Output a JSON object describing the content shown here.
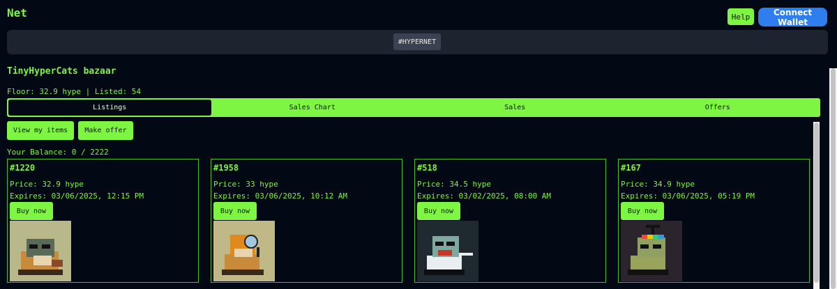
{
  "header": {
    "app_title": "Net",
    "help_label": "Help",
    "connect_label": "Connect Wallet"
  },
  "chips": {
    "hypernet": "#HYPERNET"
  },
  "market": {
    "title": "TinyHyperCats bazaar",
    "stats": "Floor: 32.9 hype | Listed: 54",
    "balance": "Your Balance: 0 / 2222"
  },
  "tabs": [
    {
      "label": "Listings",
      "active": true
    },
    {
      "label": "Sales Chart",
      "active": false
    },
    {
      "label": "Sales",
      "active": false
    },
    {
      "label": "Offers",
      "active": false
    }
  ],
  "actions": {
    "view_items": "View my items",
    "make_offer": "Make offer"
  },
  "listings": [
    {
      "id": "#1220",
      "price": "Price: 32.9 hype",
      "expires": "Expires: 03/06/2025, 12:15 PM",
      "buy": "Buy now",
      "image_bg": "#b9b88b"
    },
    {
      "id": "#1958",
      "price": "Price: 33 hype",
      "expires": "Expires: 03/06/2025, 10:12 AM",
      "buy": "Buy now",
      "image_bg": "#c1b888"
    },
    {
      "id": "#518",
      "price": "Price: 34.5 hype",
      "expires": "Expires: 03/02/2025, 08:00 AM",
      "buy": "Buy now",
      "image_bg": "#1f2a30"
    },
    {
      "id": "#167",
      "price": "Price: 34.9 hype",
      "expires": "Expires: 03/06/2025, 05:19 PM",
      "buy": "Buy now",
      "image_bg": "#2b242c"
    }
  ],
  "colors": {
    "background": "#020814",
    "accent": "#7ef542",
    "connect_button": "#2f7ef0"
  }
}
